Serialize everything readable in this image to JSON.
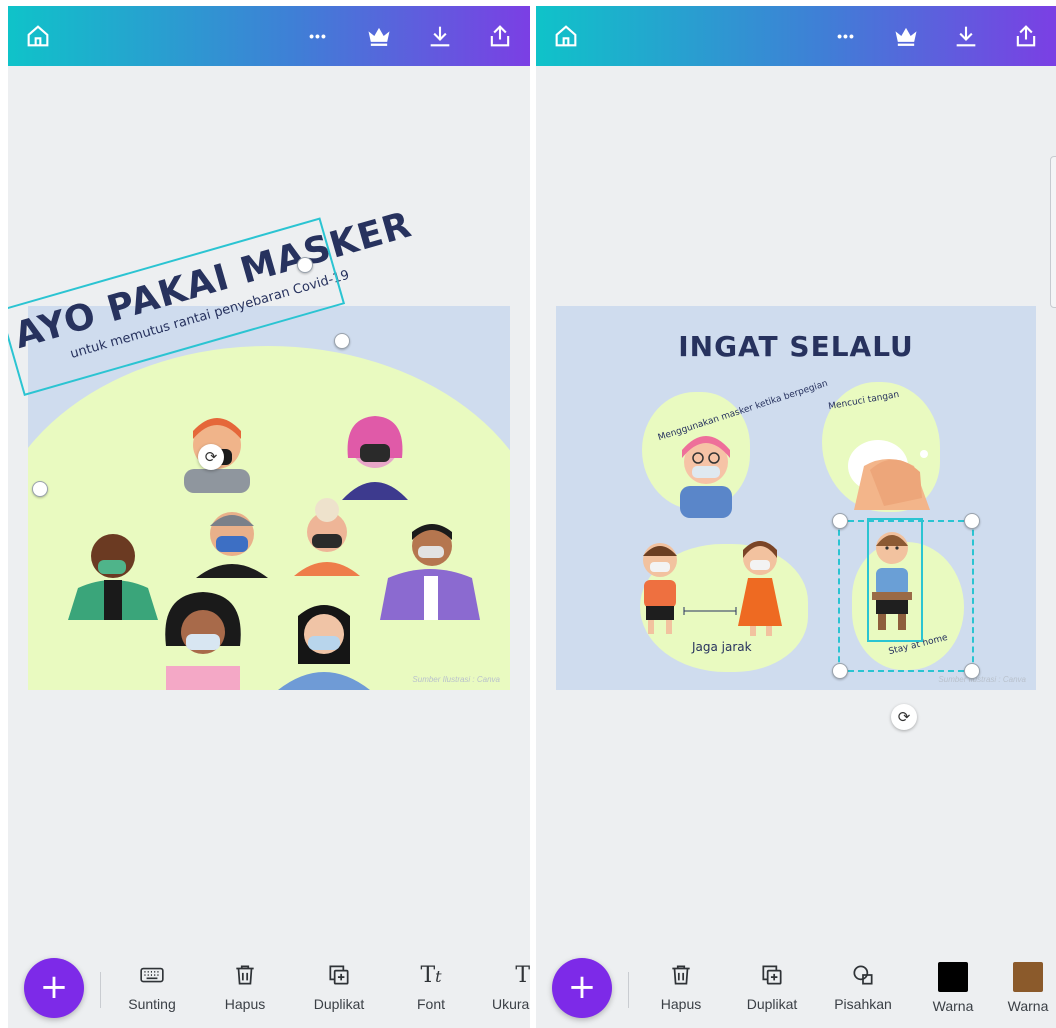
{
  "left": {
    "design": {
      "title": "AYO PAKAI MASKER",
      "subtitle": "untuk memutus rantai penyebaran Covid-19",
      "credit": "Sumber Ilustrasi : Canva"
    },
    "toolbar": [
      {
        "label": "Sunting",
        "icon": "keyboard-icon"
      },
      {
        "label": "Hapus",
        "icon": "trash-icon"
      },
      {
        "label": "Duplikat",
        "icon": "duplicate-icon"
      },
      {
        "label": "Font",
        "icon": "font-icon"
      },
      {
        "label": "Ukura",
        "icon": "size-icon"
      }
    ]
  },
  "right": {
    "design": {
      "title": "INGAT SELALU",
      "caption_mask": "Menggunakan masker ketika berpegian",
      "caption_wash": "Mencuci tangan",
      "caption_distance": "Jaga jarak",
      "caption_home": "Stay at home",
      "credit": "Sumber Ilustrasi : Canva"
    },
    "toolbar": [
      {
        "label": "Hapus",
        "icon": "trash-icon"
      },
      {
        "label": "Duplikat",
        "icon": "duplicate-icon"
      },
      {
        "label": "Pisahkan",
        "icon": "ungroup-icon"
      },
      {
        "label": "Warna",
        "icon": "color-swatch",
        "color": "#000000"
      },
      {
        "label": "Warna",
        "icon": "color-swatch",
        "color": "#8b5a2b"
      }
    ]
  },
  "topbar": {
    "icons": [
      "home-icon",
      "more-icon",
      "crown-icon",
      "download-icon",
      "share-icon"
    ],
    "more_glyph": "•••"
  },
  "fab": {
    "glyph": "+"
  },
  "rotate_glyph": "⟳",
  "colors": {
    "accent": "#7d2ae8",
    "selection": "#2bc4d2",
    "canvas": "#cfdcee",
    "blob": "#e9fac0",
    "title_ink": "#27325e"
  }
}
